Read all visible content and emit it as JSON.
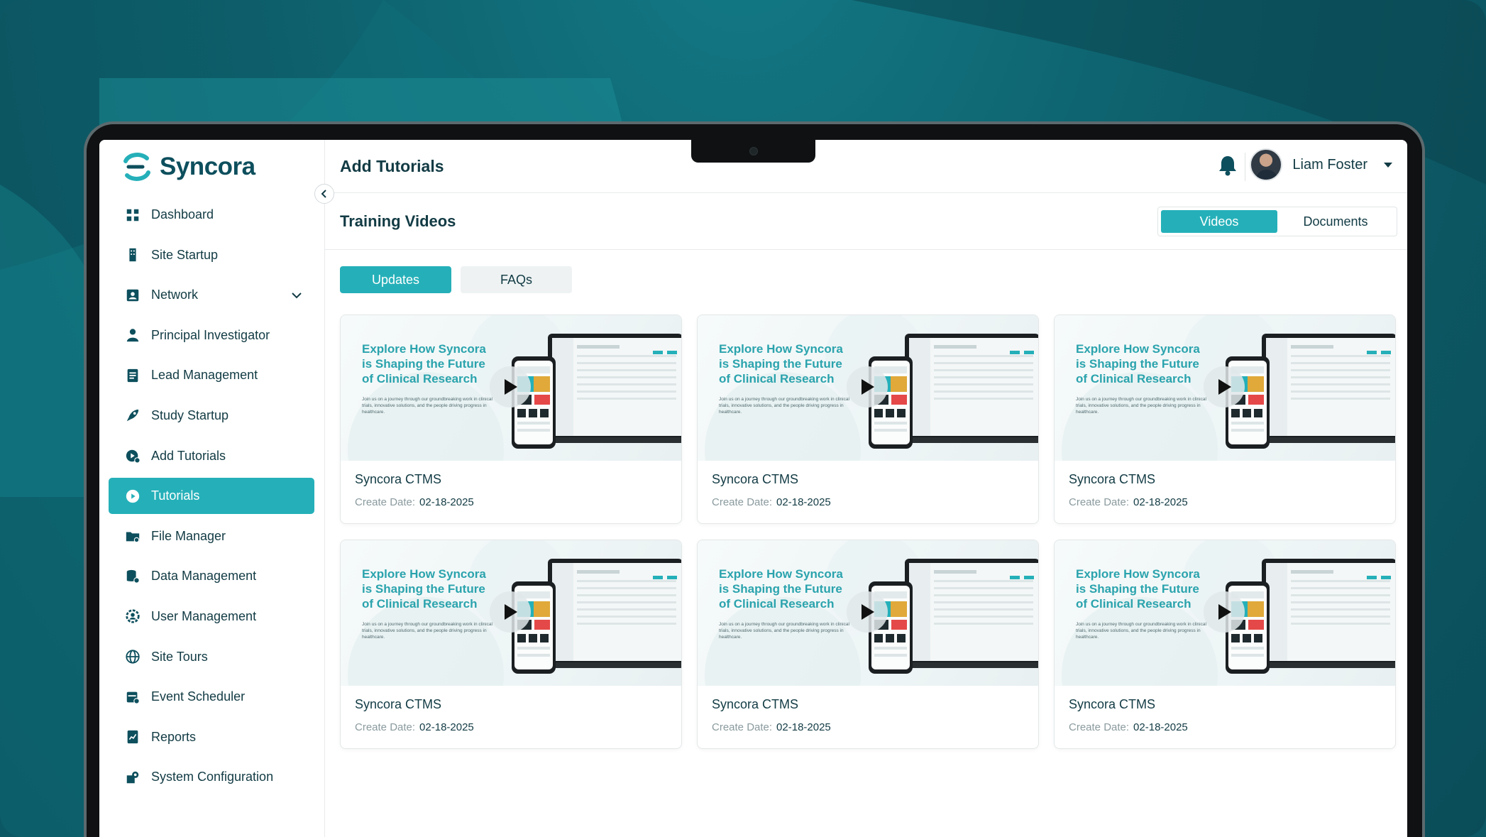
{
  "app": {
    "name": "Syncora"
  },
  "sidebar": {
    "items": [
      {
        "label": "Dashboard",
        "icon": "grid-icon"
      },
      {
        "label": "Site Startup",
        "icon": "building-icon"
      },
      {
        "label": "Network",
        "icon": "contact-card-icon",
        "expandable": true
      },
      {
        "label": "Principal Investigator",
        "icon": "person-icon"
      },
      {
        "label": "Lead Management",
        "icon": "document-list-icon"
      },
      {
        "label": "Study Startup",
        "icon": "rocket-icon"
      },
      {
        "label": "Add Tutorials",
        "icon": "video-add-icon"
      },
      {
        "label": "Tutorials",
        "icon": "play-circle-icon",
        "active": true
      },
      {
        "label": "File Manager",
        "icon": "folder-icon"
      },
      {
        "label": "Data Management",
        "icon": "database-icon"
      },
      {
        "label": "User Management",
        "icon": "user-gear-icon"
      },
      {
        "label": "Site Tours",
        "icon": "globe-icon"
      },
      {
        "label": "Event Scheduler",
        "icon": "calendar-icon"
      },
      {
        "label": "Reports",
        "icon": "report-icon"
      },
      {
        "label": "System Configuration",
        "icon": "settings-icon"
      }
    ]
  },
  "header": {
    "title": "Add Tutorials",
    "user": {
      "name": "Liam Foster"
    }
  },
  "section": {
    "title": "Training Videos",
    "toggle": {
      "videos": "Videos",
      "documents": "Documents",
      "selected": "Videos"
    }
  },
  "tabs": {
    "updates": "Updates",
    "faqs": "FAQs",
    "selected": "Updates"
  },
  "thumbnail": {
    "headline": "Explore How Syncora is Shaping the Future of Clinical Research",
    "subtext": "Join us on a journey through our groundbreaking work in clinical trials, innovative solutions, and the people driving progress in healthcare."
  },
  "videos": [
    {
      "title": "Syncora CTMS",
      "date_label": "Create Date:",
      "date": "02-18-2025"
    },
    {
      "title": "Syncora CTMS",
      "date_label": "Create Date:",
      "date": "02-18-2025"
    },
    {
      "title": "Syncora CTMS",
      "date_label": "Create Date:",
      "date": "02-18-2025"
    },
    {
      "title": "Syncora CTMS",
      "date_label": "Create Date:",
      "date": "02-18-2025"
    },
    {
      "title": "Syncora CTMS",
      "date_label": "Create Date:",
      "date": "02-18-2025"
    },
    {
      "title": "Syncora CTMS",
      "date_label": "Create Date:",
      "date": "02-18-2025"
    }
  ],
  "colors": {
    "accent": "#25b0b9",
    "brand_dark": "#0d4f5d",
    "background": "#0b5763"
  }
}
